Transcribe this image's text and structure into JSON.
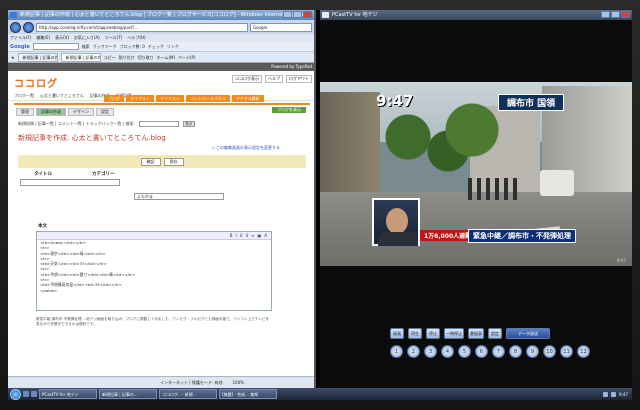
{
  "ie": {
    "title": "新規記事 | 記事の作成 | 心太と書いてところてん.blog | ブログ一覧 | ブログサービス[ココログ] - Windows Internet Explorer",
    "address": "http://app.cocolog-nifty.com/t/app/weblog/post?...",
    "search_engine": "Google",
    "menu": [
      "ファイル(F)",
      "編集(E)",
      "表示(V)",
      "お気に入り(A)",
      "ツール(T)",
      "ヘルプ(H)"
    ],
    "google_label": "Google",
    "gbar_items": [
      "検索",
      "ブックマーク",
      "ブロック数: 0",
      "チェック",
      "リンク"
    ],
    "tabs": [
      "新規記事 | 記事の作成",
      "新規記事 | 記事の作成"
    ],
    "fav_buttons": [
      "コピー",
      "貼り付け",
      "切り取り",
      "ホーム(M)",
      "ページ(P)"
    ],
    "typepad_bar": "Powered by TypePad",
    "logo": "ココログ",
    "head_links": [
      "ココログ表示",
      "ヘルプ",
      "ログアウト"
    ],
    "crumbs": [
      "ブログ一覧",
      "心太と書いてところてん",
      "記事の作成",
      "新規記事"
    ],
    "orange_tabs": [
      "ブログ",
      "マイフォト",
      "マイリスト",
      "コントロールパネル",
      "アクセス解析"
    ],
    "subtabs": [
      "管理",
      "記事の作成",
      "デザイン",
      "設定"
    ],
    "profile_btn": "ブログを表示",
    "link_row": "新規投稿 | 記事一覧 | コメント一覧 | トラックバック一覧 | 検索:",
    "search_btn": "表示",
    "new_title": "新規記事を作成: 心太と書いてところてん.blog",
    "caution": "» この編集画面の表示設定を変更する",
    "buttons": [
      "確認",
      "保存"
    ],
    "title_label": "タイトル",
    "category_label": "カテゴリー",
    "category_value": "よもやま",
    "body_label": "本文",
    "editor_lines": [
      "<td>&nbsp;</td></tr>",
      "<tr>",
      "<td>東京</td><td>晴</td></tr>",
      "<tr>",
      "<td>天気</td><td>33</td></tr>",
      "<tr>",
      "<td>予想</td><td>雲り</td><td>晴</td></tr>",
      "<tr>",
      "<td>予想最高気温</td><td>35</td></tr>",
      "</table>"
    ],
    "note": "緊急中継 調布市 不発弾処理… 地デジ画面を取り込み、ブログに掲載してみました。ワンセグ・フルセグとも録画可能で、パソコン上でテレビを見ながら作業ができるのは便利です。",
    "status": [
      "インターネット | 保護モード: 有効",
      "100%"
    ]
  },
  "tv": {
    "title": "PCastTV for 地デジ",
    "clock": "9:47",
    "location": "調布市 国領",
    "ticker_red": "1万6,000人避難",
    "ticker_blue": "緊急中継／調布市・不発弾処理",
    "small_clock": "9:47",
    "top_buttons": [
      "録画",
      "再生",
      "停止",
      "一時停止",
      "番組表",
      "設定"
    ],
    "long_button": "データ放送",
    "numbers": [
      "1",
      "2",
      "3",
      "4",
      "5",
      "6",
      "7",
      "8",
      "9",
      "10",
      "11",
      "12"
    ]
  },
  "taskbar": {
    "tasks": [
      "PCastTV for 地デジ",
      "新規記事 | 記事の...",
      "ココログ…- 新規...",
      "[無題] - 完成… 無知"
    ],
    "time": "9:47"
  }
}
